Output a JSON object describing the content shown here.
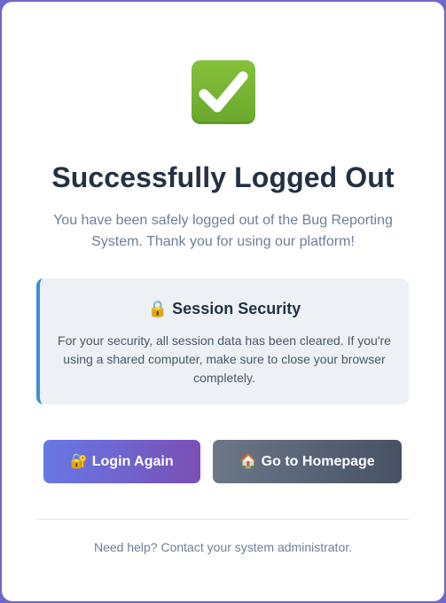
{
  "page": {
    "title": "Successfully Logged Out",
    "subtitle": "You have been safely logged out of the Bug Reporting System. Thank you for using our platform!",
    "status_icon": "check-mark-icon"
  },
  "security_notice": {
    "icon": "lock-icon",
    "title": "🔒 Session Security",
    "text": "For your security, all session data has been cleared. If you're using a shared computer, make sure to close your browser completely."
  },
  "actions": {
    "login_label": "🔐 Login Again",
    "home_label": "🏠 Go to Homepage"
  },
  "footer": {
    "help_text": "Need help? Contact your system administrator."
  },
  "colors": {
    "accent_border": "#3d8fd8",
    "login_gradient_start": "#6778e6",
    "login_gradient_end": "#7a4fb5",
    "home_gradient_start": "#6c7889",
    "home_gradient_end": "#465263",
    "success_green": "#77b33a"
  }
}
